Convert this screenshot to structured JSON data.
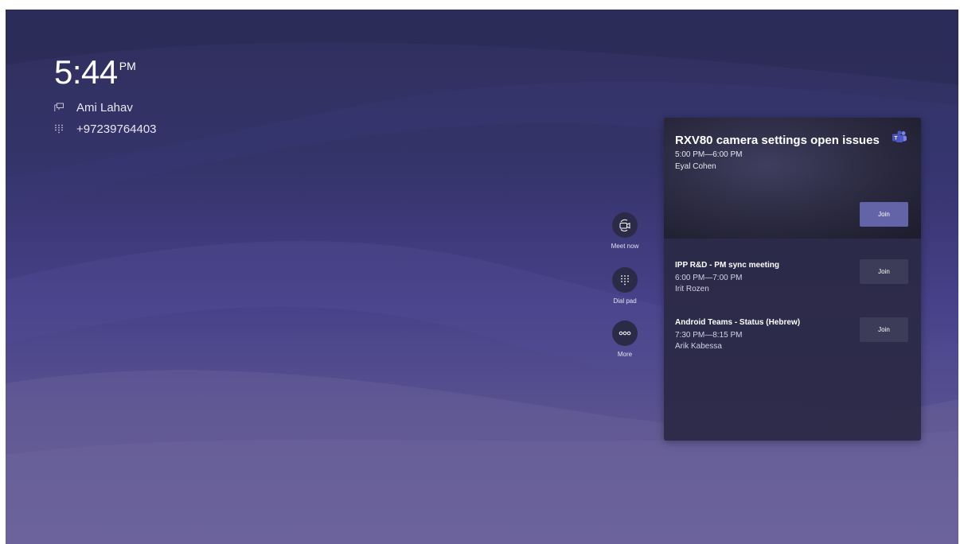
{
  "home": {
    "time": "5:44",
    "ampm": "PM",
    "room_name": "Ami Lahav",
    "phone_number": "+97239764403"
  },
  "actions": [
    {
      "label": "Meet now",
      "icon": "video-camera-icon"
    },
    {
      "label": "Dial pad",
      "icon": "dial-pad-icon"
    },
    {
      "label": "More",
      "icon": "more-icon"
    }
  ],
  "meetings": [
    {
      "title": "RXV80 camera settings open issues",
      "time": "5:00 PM—6:00 PM",
      "organizer": "Eyal Cohen",
      "join_label": "Join",
      "icon": "teams-icon"
    },
    {
      "title": "IPP R&D - PM sync meeting",
      "time": "6:00 PM—7:00 PM",
      "organizer": "Irit Rozen",
      "join_label": "Join"
    },
    {
      "title": "Android Teams - Status (Hebrew)",
      "time": "7:30 PM—8:15 PM",
      "organizer": "Arik Kabessa",
      "join_label": "Join"
    }
  ],
  "colors": {
    "accent": "#6264a7",
    "panel": "#2b2945",
    "background_top": "#2f2f5c",
    "background_bottom": "#6b6399"
  }
}
